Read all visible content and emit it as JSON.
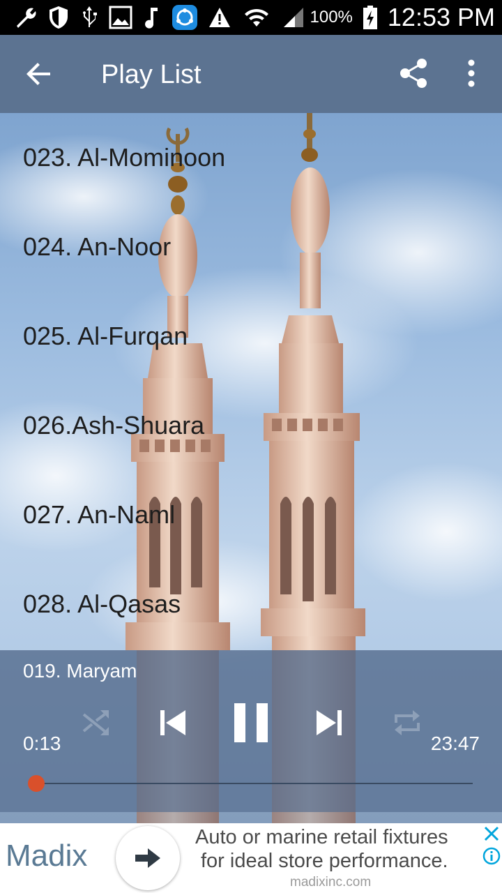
{
  "status_bar": {
    "icons": [
      "wrench-icon",
      "shield-icon",
      "usb-icon",
      "image-icon",
      "music-note-icon",
      "share-it-icon",
      "warning-icon",
      "wifi-icon",
      "signal-icon",
      "battery-charging-icon"
    ],
    "battery": "100%",
    "time": "12:53 PM"
  },
  "app_bar": {
    "title": "Play List",
    "color": "#5c7391"
  },
  "playlist": {
    "items": [
      "023. Al-Mominoon",
      "024. An-Noor",
      "025. Al-Furqan",
      "026.Ash-Shuara",
      "027. An-Naml",
      "028. Al-Qasas"
    ]
  },
  "player": {
    "now_playing": "019. Maryam",
    "elapsed": "0:13",
    "duration": "23:47",
    "progress_fraction": 0.01,
    "accent": "#d9502b"
  },
  "ad": {
    "brand": "Madix",
    "line1": "Auto or marine retail fixtures",
    "line2": "for ideal store performance.",
    "url": "madixinc.com",
    "accent": "#00a5dc"
  }
}
